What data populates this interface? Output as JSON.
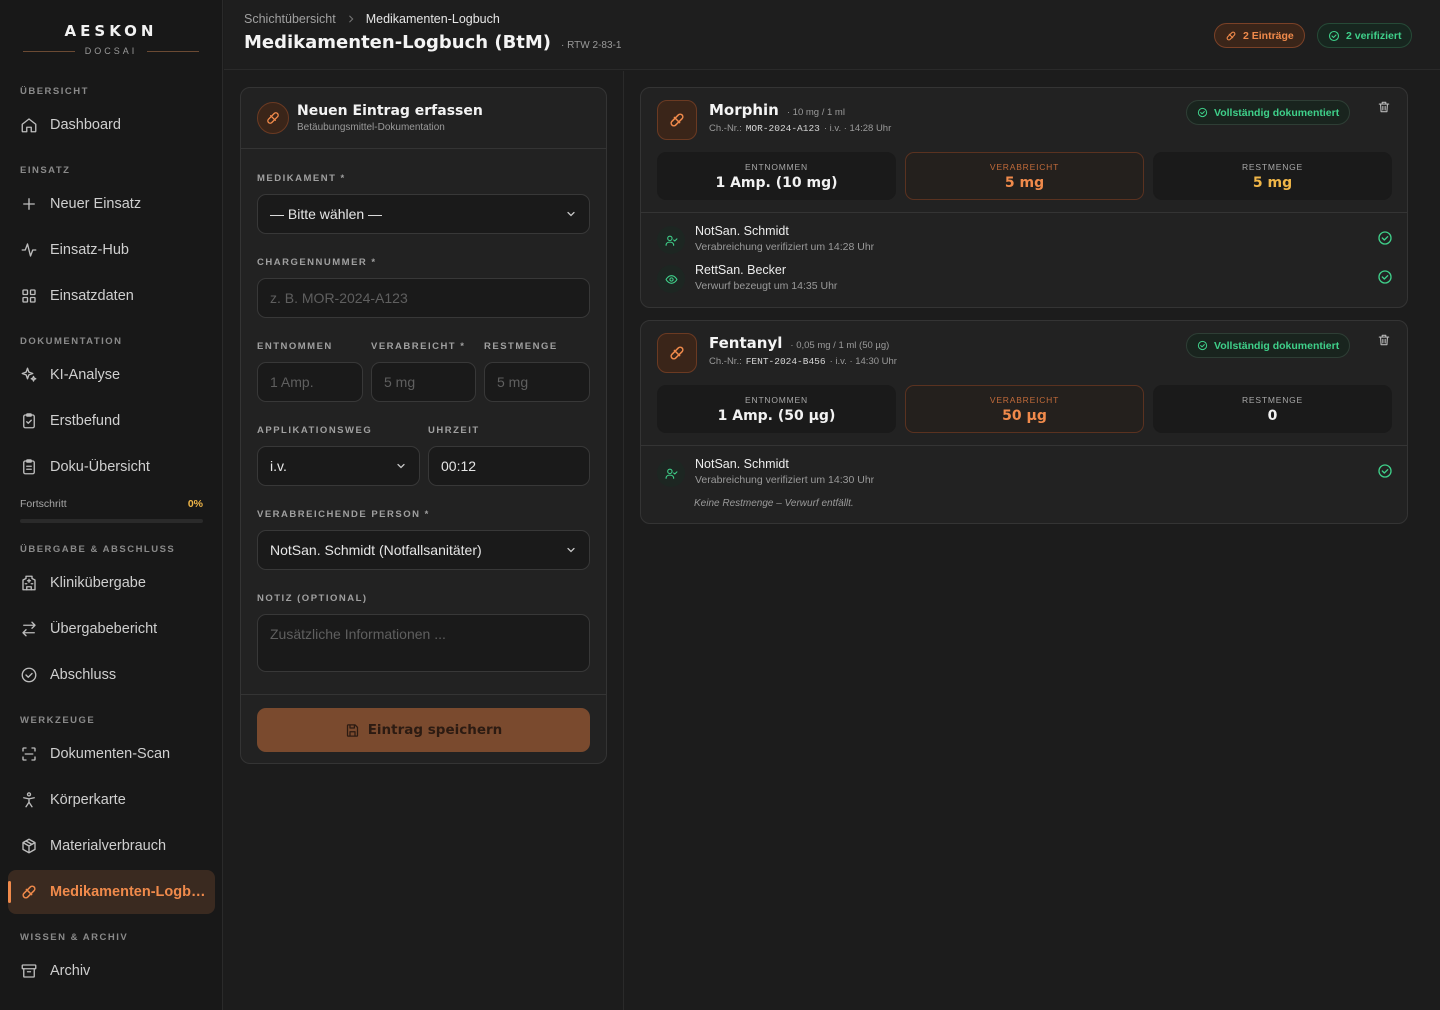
{
  "brand": {
    "name": "AESKON",
    "sub": "DOCSAI"
  },
  "sidebar": {
    "sections": [
      {
        "label": "ÜBERSICHT"
      },
      {
        "label": "EINSATZ"
      },
      {
        "label": "DOKUMENTATION"
      },
      {
        "label": "ÜBERGABE & ABSCHLUSS"
      },
      {
        "label": "WERKZEUGE"
      },
      {
        "label": "WISSEN & ARCHIV"
      }
    ],
    "items": [
      {
        "label": "Dashboard",
        "icon": "home-icon"
      },
      {
        "label": "Neuer Einsatz",
        "icon": "plus-icon"
      },
      {
        "label": "Einsatz-Hub",
        "icon": "activity-icon"
      },
      {
        "label": "Einsatzdaten",
        "icon": "grid-icon"
      },
      {
        "label": "KI-Analyse",
        "icon": "sparkles-icon"
      },
      {
        "label": "Erstbefund",
        "icon": "clipboard-check-icon"
      },
      {
        "label": "Doku-Übersicht",
        "icon": "clipboard-list-icon"
      },
      {
        "label": "Klinikübergabe",
        "icon": "hospital-icon"
      },
      {
        "label": "Übergabebericht",
        "icon": "arrows-exchange-icon"
      },
      {
        "label": "Abschluss",
        "icon": "check-circle-icon"
      },
      {
        "label": "Dokumenten-Scan",
        "icon": "scan-icon"
      },
      {
        "label": "Körperkarte",
        "icon": "body-icon"
      },
      {
        "label": "Materialverbrauch",
        "icon": "package-icon"
      },
      {
        "label": "Medikamenten-Logbuch",
        "icon": "pill-icon"
      },
      {
        "label": "Archiv",
        "icon": "archive-icon"
      }
    ],
    "progress": {
      "label": "Fortschritt",
      "value_text": "0%",
      "value": 0
    }
  },
  "header": {
    "breadcrumb": [
      "Schichtübersicht",
      "Medikamenten-Logbuch"
    ],
    "title": "Medikamenten-Logbuch (BtM)",
    "subtitle": "· RTW 2-83-1",
    "entries_badge": "2 Einträge",
    "verified_badge": "2 verifiziert"
  },
  "form": {
    "title": "Neuen Eintrag erfassen",
    "subtitle": "Betäubungsmittel-Dokumentation",
    "medikament_label": "MEDIKAMENT *",
    "medikament_value": "— Bitte wählen —",
    "charge_label": "CHARGENNUMMER *",
    "charge_placeholder": "z. B. MOR-2024-A123",
    "entnommen_label": "ENTNOMMEN",
    "entnommen_placeholder": "1 Amp.",
    "verabreicht_label": "VERABREICHT *",
    "verabreicht_placeholder": "5 mg",
    "restmenge_label": "RESTMENGE",
    "restmenge_placeholder": "5 mg",
    "applikation_label": "APPLIKATIONSWEG",
    "applikation_value": "i.v.",
    "uhrzeit_label": "UHRZEIT",
    "uhrzeit_value": "00:12",
    "person_label": "VERABREICHENDE PERSON *",
    "person_value": "NotSan. Schmidt (Notfallsanitäter)",
    "notiz_label": "NOTIZ (OPTIONAL)",
    "notiz_placeholder": "Zusätzliche Informationen ...",
    "save_label": "Eintrag speichern"
  },
  "entries": [
    {
      "name": "Morphin",
      "dose": "· 10 mg / 1 ml",
      "charge_prefix": "Ch.-Nr.:",
      "charge": "MOR-2024-A123",
      "meta": "· i.v. · 14:28 Uhr",
      "status": "Vollständig dokumentiert",
      "entnommen_label": "ENTNOMMEN",
      "entnommen": "1 Amp. (10 mg)",
      "verabreicht_label": "VERABREICHT",
      "verabreicht": "5 mg",
      "rest_label": "RESTMENGE",
      "rest": "5 mg",
      "persons": [
        {
          "name": "NotSan. Schmidt",
          "detail": "Verabreichung verifiziert um 14:28 Uhr",
          "icon": "user-check-icon"
        },
        {
          "name": "RettSan. Becker",
          "detail": "Verwurf bezeugt um 14:35 Uhr",
          "icon": "eye-icon"
        }
      ]
    },
    {
      "name": "Fentanyl",
      "dose": "· 0,05 mg / 1 ml (50 µg)",
      "charge_prefix": "Ch.-Nr.:",
      "charge": "FENT-2024-B456",
      "meta": "· i.v. · 14:30 Uhr",
      "status": "Vollständig dokumentiert",
      "entnommen_label": "ENTNOMMEN",
      "entnommen": "1 Amp. (50 µg)",
      "verabreicht_label": "VERABREICHT",
      "verabreicht": "50 µg",
      "rest_label": "RESTMENGE",
      "rest": "0",
      "persons": [
        {
          "name": "NotSan. Schmidt",
          "detail": "Verabreichung verifiziert um 14:30 Uhr",
          "icon": "user-check-icon"
        }
      ],
      "note": "Keine Restmenge – Verwurf entfällt."
    }
  ],
  "colors": {
    "accent": "#f08a4b",
    "success": "#3fd08a",
    "warning": "#f0b648",
    "background": "#1c1c1c"
  }
}
